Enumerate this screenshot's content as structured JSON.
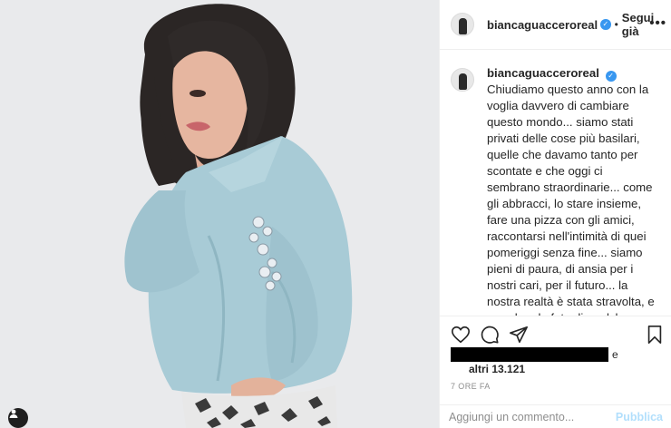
{
  "post": {
    "username": "biancaguacceroreal",
    "follow_separator": "•",
    "follow_label": "Segui già",
    "more_icon": "•••",
    "caption": "Chiudiamo questo anno con la voglia davvero di cambiare questo mondo... siamo stati privati delle cose più basilari, quelle che davamo tanto per scontate e che oggi ci sembrano straordinarie... come gli abbracci, lo stare insieme, fare una pizza con gli amici, raccontarsi nell'intimità di quei pomeriggi senza fine... siamo pieni di paura, di ansia per i nostri cari, per il futuro... la nostra realtà è stata stravolta, e guardare le foto di qualche anno fa, fa male al cuore... allora pensiamoci, ma facciamolo sul serio... e non dimentichiamo che questo sarà il mondo che erediteranno i nostri figli... che il nuovo anno possa diventare per tutti",
    "likes_connector": "e",
    "likes_others": "altri 13.121",
    "timestamp": "7 ORE FA",
    "comment_placeholder": "Aggiungi un commento...",
    "publish_label": "Pubblica"
  },
  "icons": {
    "verified": "verified-badge-icon",
    "like": "heart-icon",
    "comment": "comment-icon",
    "share": "paper-plane-icon",
    "save": "bookmark-icon",
    "tag": "user-tag-icon"
  },
  "colors": {
    "verified_blue": "#3897f0",
    "publish_disabled": "#b2dffc",
    "muted_text": "#8e8e8e",
    "shirt": "#a8cbd6"
  }
}
